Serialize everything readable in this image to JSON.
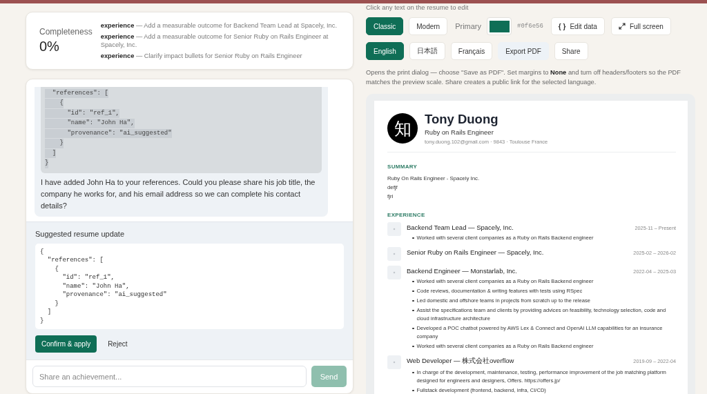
{
  "completeness": {
    "label": "Completeness",
    "value": "0%",
    "suggestions": [
      "**experience** — Add a measurable outcome for Backend Team Lead at Spacely, Inc.",
      "**experience** — Add a measurable outcome for Senior Ruby on Rails Engineer at Spacely, Inc.",
      "**experience** — Clarify impact bullets for Senior Ruby on Rails Engineer"
    ]
  },
  "chat": {
    "message": {
      "code_lines": [
        "  \"references\": [",
        "    {",
        "      \"id\": \"ref_1\",",
        "      \"name\": \"John Ha\",",
        "      \"provenance\": \"ai_suggested\"",
        "    }",
        "  ]",
        "}"
      ],
      "text": "I have added John Ha to your references. Could you please share his job title, the company he works for, and his email address so we can complete his contact details?"
    },
    "suggestion": {
      "title": "Suggested resume update",
      "code_lines": [
        "{",
        "  \"references\": [",
        "    {",
        "      \"id\": \"ref_1\",",
        "      \"name\": \"John Ha\",",
        "      \"provenance\": \"ai_suggested\"",
        "    }",
        "  ]",
        "}"
      ],
      "buttons": [
        {
          "kind": "primary",
          "label": "Confirm & apply"
        },
        {
          "kind": "text",
          "label": "Reject"
        }
      ]
    },
    "composer": {
      "placeholder": "Share an achievement...",
      "send": {
        "label": "Send",
        "disabled": true
      }
    }
  },
  "editor": {
    "hint": "Click any text on the resume to edit",
    "templates": [
      {
        "label": "Classic",
        "selected": true
      },
      {
        "label": "Modern",
        "selected": false
      }
    ],
    "primary": {
      "label": "Primary",
      "color": "#0f6e56",
      "hex": "#0f6e56"
    },
    "actions": [
      {
        "kind": "data",
        "icon_text": "{ }",
        "label": "Edit data"
      },
      {
        "kind": "fullscreen",
        "label": "Full screen"
      }
    ],
    "languages": [
      {
        "label": "English",
        "selected": true
      },
      {
        "label": "日本語",
        "selected": false
      },
      {
        "label": "Français",
        "selected": false
      }
    ],
    "exports": [
      {
        "kind": "soft",
        "label": "Export PDF"
      },
      {
        "kind": "outline",
        "label": "Share"
      }
    ],
    "note": "Opens the print dialog — choose \"Save as PDF\". Set margins to **None** and turn off headers/footers so the PDF matches the preview scale. Share creates a public link for the selected language."
  },
  "resume": {
    "avatar_text": "知",
    "name": "Tony Duong",
    "title": "Ruby on Rails Engineer",
    "contact": "tony.duong.102@gmail.com · 9843 · Toulouse France",
    "sections": [
      {
        "kind": "lines",
        "heading": "SUMMARY",
        "lines": [
          "Ruby On Rails Engineer - Spacely Inc.",
          "defjf",
          "fjri"
        ]
      },
      {
        "kind": "entries",
        "heading": "EXPERIENCE",
        "entries": [
          {
            "title": "Backend Team Lead — Spacely, Inc.",
            "dates": "2025-11 – Present",
            "bullets": [
              "Worked with several client companies as a Ruby on Rails Backend engineer"
            ]
          },
          {
            "title": "Senior Ruby on Rails Engineer — Spacely, Inc.",
            "dates": "2025-02 – 2026-02"
          },
          {
            "title": "Backend Engineer — Monstarlab, Inc.",
            "dates": "2022-04 – 2025-03",
            "bullets": [
              "Worked with several client companies as a Ruby on Rails Backend engineer",
              "Code reviews, documentation & writing features with tests using RSpec",
              "Led domestic and offshore teams in projects from scratch up to the release",
              "Assist the specifications team and clients by providing advices on feasibility, technology selection, code and cloud infrastructure architecture",
              "Developed a POC chatbot powered by AWS Lex & Connect and OpenAI LLM capabilities for an insurance company",
              "Worked with several client companies as a Ruby on Rails Backend engineer"
            ]
          },
          {
            "title": "Web Developer — 株式会社overflow",
            "dates": "2019-09 – 2022-04",
            "bullets": [
              "In charge of the development, maintenance, testing, performance improvement of the job matching platform designed for engineers and designers, Offers. https://offers.jp/",
              "Fullstack development (frontend, backend, infra, CI/CD)"
            ]
          }
        ]
      }
    ]
  }
}
